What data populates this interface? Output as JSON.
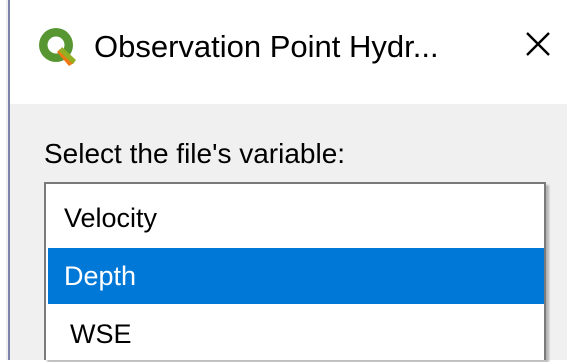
{
  "window": {
    "title": "Observation Point Hydr...",
    "app_icon": "qgis-icon",
    "close_icon": "close-icon",
    "accent_color": "#0078d7"
  },
  "dialog": {
    "prompt_label": "Select the file's variable:",
    "variable_options": [
      {
        "label": "Velocity",
        "selected": false
      },
      {
        "label": "Depth",
        "selected": true
      },
      {
        "label": "WSE",
        "selected": false
      }
    ]
  }
}
